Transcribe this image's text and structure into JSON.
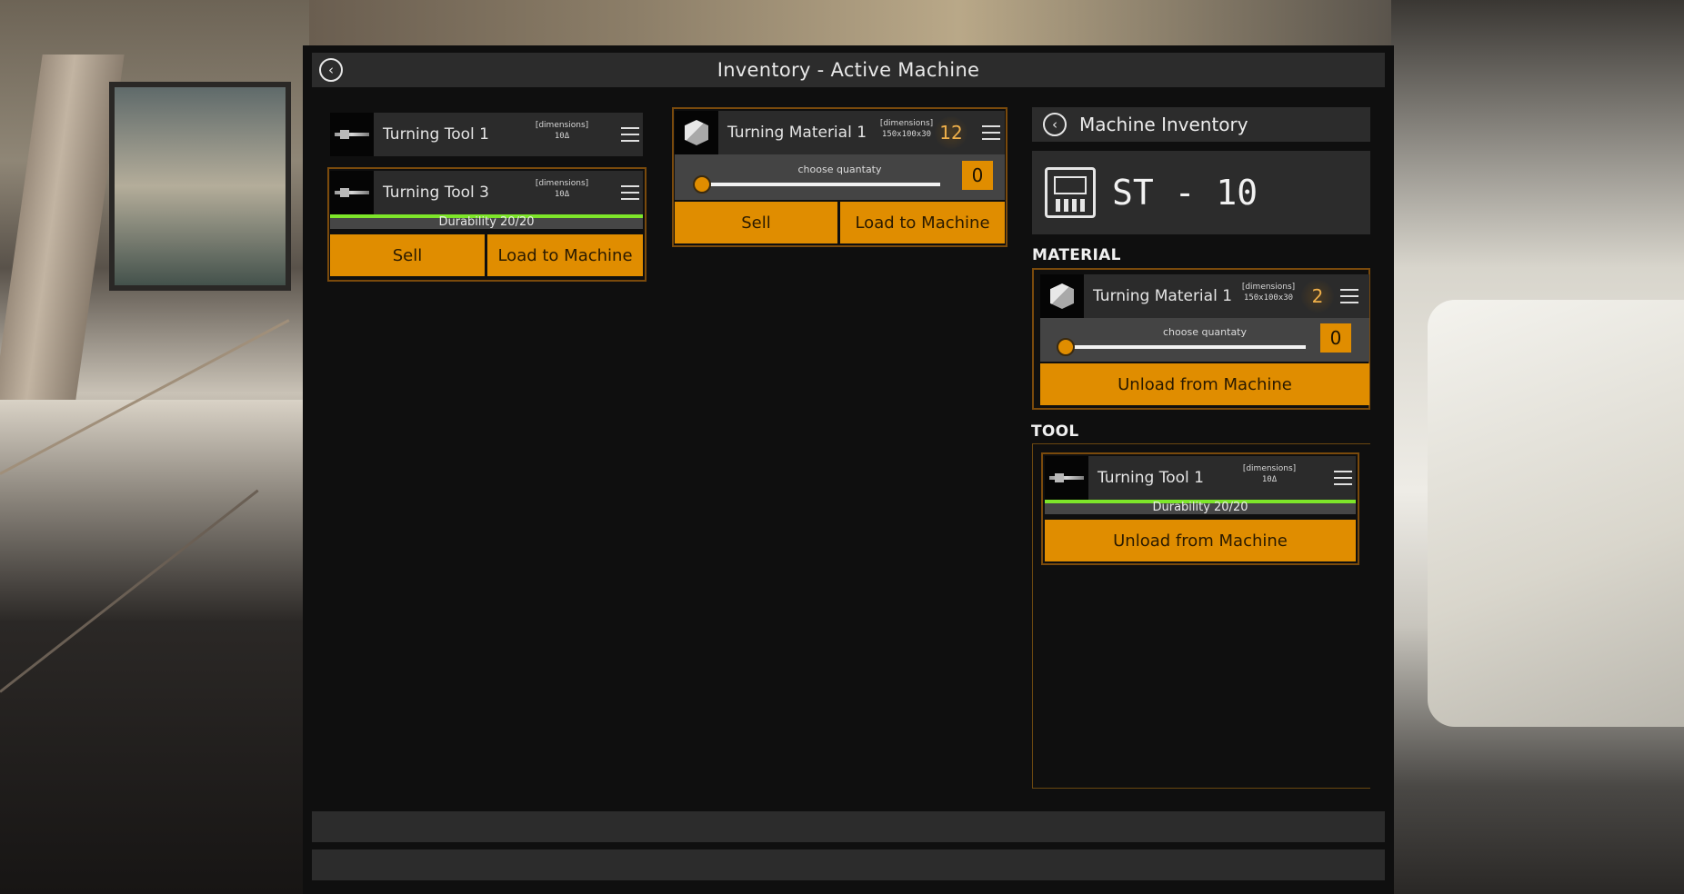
{
  "window": {
    "title": "Inventory - Active Machine"
  },
  "inventory": {
    "tools": [
      {
        "name": "Turning Tool 1",
        "dims_label": "[dimensions]",
        "dims_value": "10Δ"
      },
      {
        "name": "Turning Tool 3",
        "dims_label": "[dimensions]",
        "dims_value": "10Δ",
        "durability": "Durability 20/20",
        "durability_fraction": 1.0,
        "sell_label": "Sell",
        "load_label": "Load to Machine"
      }
    ],
    "materials": [
      {
        "name": "Turning Material 1",
        "dims_label": "[dimensions]",
        "dims_value": "150x100x30",
        "count": "12",
        "qty_label": "choose quantaty",
        "qty_value": "0",
        "slider_fraction": 0.0,
        "sell_label": "Sell",
        "load_label": "Load to Machine"
      }
    ]
  },
  "machine": {
    "header": "Machine Inventory",
    "name": "ST - 10",
    "material_section": "MATERIAL",
    "tool_section": "TOOL",
    "material": {
      "name": "Turning Material 1",
      "dims_label": "[dimensions]",
      "dims_value": "150x100x30",
      "count": "2",
      "qty_label": "choose quantaty",
      "qty_value": "0",
      "slider_fraction": 0.0,
      "unload_label": "Unload from Machine"
    },
    "tool": {
      "name": "Turning Tool 1",
      "dims_label": "[dimensions]",
      "dims_value": "10Δ",
      "durability": "Durability 20/20",
      "durability_fraction": 1.0,
      "unload_label": "Unload from Machine"
    }
  },
  "colors": {
    "accent": "#e08d00",
    "durability": "#7ee62a",
    "panel": "#0f0f0f",
    "bar": "#2c2c2c"
  },
  "icons": {
    "back": "back-arrow-circle-icon",
    "menu": "hamburger-menu-icon",
    "tool": "turning-tool-icon",
    "material": "material-cube-icon",
    "machine": "cnc-machine-icon"
  }
}
